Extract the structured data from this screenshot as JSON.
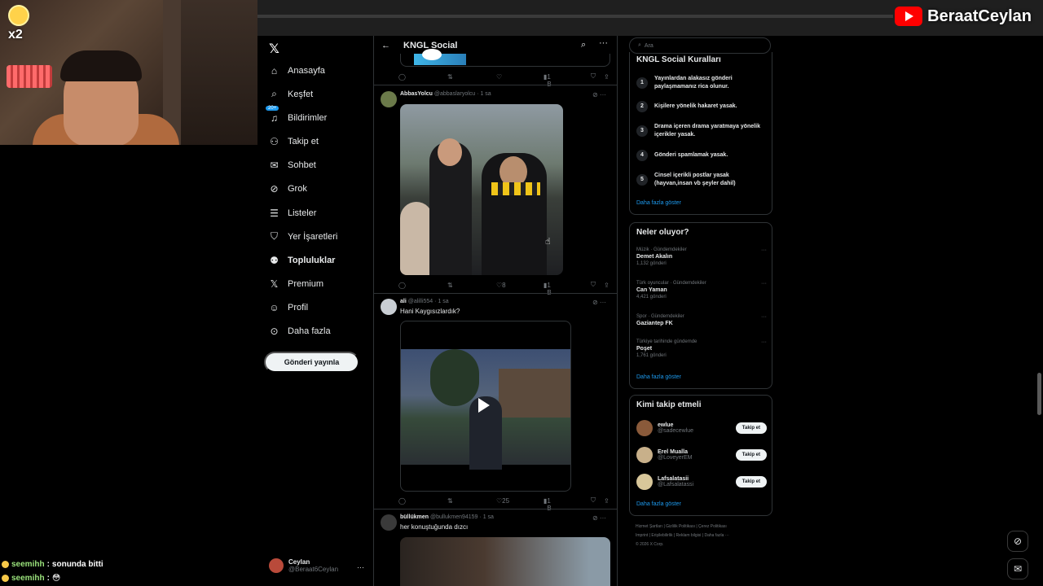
{
  "overlay": {
    "badge_text": "x2",
    "channel_name": "BeraatCeylan",
    "chat": [
      {
        "user": "seemihh",
        "message": "sonunda bitti"
      },
      {
        "user": "seemihh",
        "message": "😳"
      }
    ]
  },
  "nav": {
    "logo": "𝕏",
    "notif_badge": "20+",
    "items": [
      {
        "label": "Anasayfa",
        "icon": "home-icon",
        "glyph": "⌂"
      },
      {
        "label": "Keşfet",
        "icon": "search-icon",
        "glyph": "⌕"
      },
      {
        "label": "Bildirimler",
        "icon": "bell-icon",
        "glyph": "♫"
      },
      {
        "label": "Takip et",
        "icon": "add-user-icon",
        "glyph": "⚇"
      },
      {
        "label": "Sohbet",
        "icon": "mail-icon",
        "glyph": "✉"
      },
      {
        "label": "Grok",
        "icon": "grok-icon",
        "glyph": "⊘"
      },
      {
        "label": "Listeler",
        "icon": "list-icon",
        "glyph": "☰"
      },
      {
        "label": "Yer İşaretleri",
        "icon": "bookmark-icon",
        "glyph": "⛉"
      },
      {
        "label": "Topluluklar",
        "icon": "communities-icon",
        "glyph": "⚉"
      },
      {
        "label": "Premium",
        "icon": "x-premium-icon",
        "glyph": "𝕏"
      },
      {
        "label": "Profil",
        "icon": "profile-icon",
        "glyph": "☺"
      },
      {
        "label": "Daha fazla",
        "icon": "more-circle-icon",
        "glyph": "⊙"
      }
    ],
    "post_button": "Gönderi yayınla",
    "profile": {
      "name": "Ceylan",
      "handle": "@Beraat6Ceylan",
      "more": "···"
    }
  },
  "feed": {
    "title": "KNGL Social",
    "prev_actions": {
      "views": "1 B"
    },
    "tweets": [
      {
        "name": "AbbasYolcu",
        "handle": "@abbaslaryolcu",
        "time": "1 sa",
        "text": "",
        "likes": "8",
        "views": "1 B"
      },
      {
        "name": "ali",
        "handle": "@alilli554",
        "time": "1 sa",
        "text": "Hani Kaygısızlardık?",
        "likes": "25",
        "views": "1 B"
      },
      {
        "name": "büllükmen",
        "handle": "@bullukmen94159",
        "time": "1 sa",
        "text": "her konuştuğunda dızcı"
      }
    ]
  },
  "right": {
    "search_placeholder": "Ara",
    "rules": {
      "title": "KNGL Social Kuralları",
      "items": [
        {
          "num": "1",
          "text": "Yayınlardan alakasız gönderi paylaşmamanız rica olunur."
        },
        {
          "num": "2",
          "text": "Kişilere yönelik hakaret yasak."
        },
        {
          "num": "3",
          "text": "Drama içeren drama yaratmaya yönelik içerikler yasak."
        },
        {
          "num": "4",
          "text": "Gönderi spamlamak yasak."
        },
        {
          "num": "5",
          "text": "Cinsel içerikli postlar yasak (hayvan,insan vb şeyler dahil)"
        }
      ],
      "more": "Daha fazla göster"
    },
    "trends": {
      "title": "Neler oluyor?",
      "items": [
        {
          "meta": "Müzik · Gündemdekiler",
          "name": "Demet Akalın",
          "count": "1,132 gönderi"
        },
        {
          "meta": "Türk oyuncular · Gündemdekiler",
          "name": "Can Yaman",
          "count": "4,421 gönderi"
        },
        {
          "meta": "Spor · Gündemdekiler",
          "name": "Gaziantep FK",
          "count": ""
        },
        {
          "meta": "Türkiye tarihinde gündemde",
          "name": "Poşet",
          "count": "1,761 gönderi"
        }
      ],
      "more": "Daha fazla göster"
    },
    "who": {
      "title": "Kimi takip etmeli",
      "items": [
        {
          "name": "ewlue",
          "handle": "@sadecewlue",
          "button": "Takip et"
        },
        {
          "name": "Erel Mualla",
          "handle": "@LoveyerEM",
          "button": "Takip et"
        },
        {
          "name": "Lafsalatasii",
          "handle": "@Lafsalatassi",
          "button": "Takip et"
        }
      ],
      "more": "Daha fazla göster"
    },
    "footer": {
      "line1": "Hizmet Şartları  |  Gizlilik Politikası  |  Çerez Politikası",
      "line2": "Imprint  |  Erişilebilirlik  |  Reklam bilgisi  |  Daha fazla ···",
      "line3": "© 2026 X Corp."
    }
  }
}
